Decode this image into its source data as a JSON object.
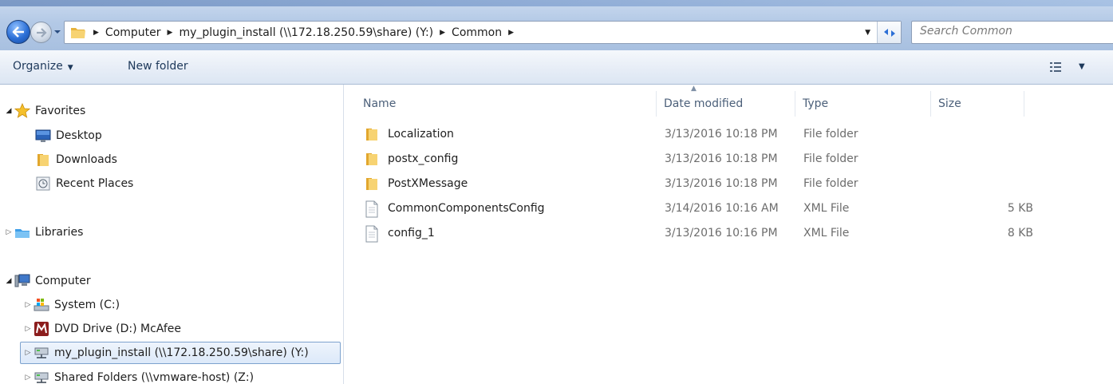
{
  "address": {
    "crumbs": [
      "Computer",
      "my_plugin_install (\\\\172.18.250.59\\share) (Y:)",
      "Common"
    ]
  },
  "search": {
    "placeholder": "Search Common"
  },
  "toolbar": {
    "organize_label": "Organize",
    "new_folder_label": "New folder"
  },
  "nav": {
    "favorites": "Favorites",
    "desktop": "Desktop",
    "downloads": "Downloads",
    "recent": "Recent Places",
    "libraries": "Libraries",
    "computer": "Computer",
    "system": "System (C:)",
    "dvd": "DVD Drive (D:) McAfee",
    "plugin": "my_plugin_install (\\\\172.18.250.59\\share) (Y:)",
    "shared": "Shared Folders (\\\\vmware-host) (Z:)"
  },
  "columns": {
    "name": "Name",
    "date": "Date modified",
    "type": "Type",
    "size": "Size"
  },
  "files": [
    {
      "name": "Localization",
      "date": "3/13/2016 10:18 PM",
      "type": "File folder",
      "size": "",
      "icon": "folder-icon"
    },
    {
      "name": "postx_config",
      "date": "3/13/2016 10:18 PM",
      "type": "File folder",
      "size": "",
      "icon": "folder-icon"
    },
    {
      "name": "PostXMessage",
      "date": "3/13/2016 10:18 PM",
      "type": "File folder",
      "size": "",
      "icon": "folder-icon"
    },
    {
      "name": "CommonComponentsConfig",
      "date": "3/14/2016 10:16 AM",
      "type": "XML File",
      "size": "5 KB",
      "icon": "xml-file-icon"
    },
    {
      "name": "config_1",
      "date": "3/13/2016 10:16 PM",
      "type": "XML File",
      "size": "8 KB",
      "icon": "xml-file-icon"
    }
  ],
  "colors": {
    "accent": "#1e395b",
    "selection": "#dce9f9",
    "folder": "#e8b23a"
  }
}
